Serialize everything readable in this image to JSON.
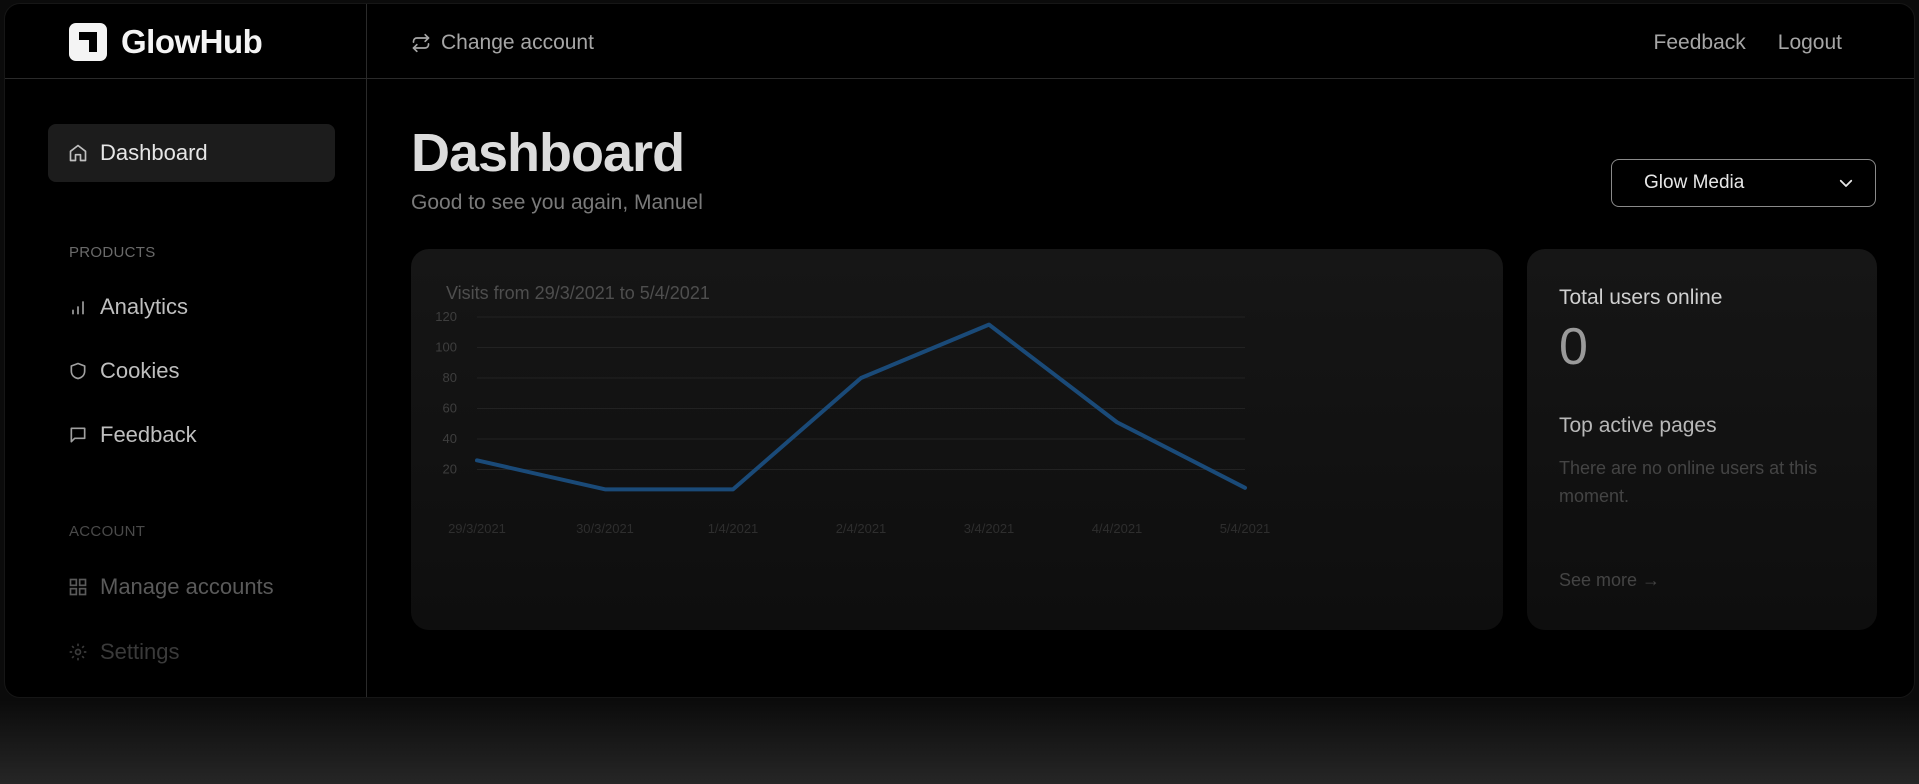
{
  "app": {
    "name": "GlowHub"
  },
  "topbar": {
    "change_account": "Change account",
    "feedback": "Feedback",
    "logout": "Logout"
  },
  "sidebar": {
    "dashboard": "Dashboard",
    "products_label": "PRODUCTS",
    "analytics": "Analytics",
    "cookies": "Cookies",
    "feedback": "Feedback",
    "account_label": "ACCOUNT",
    "manage_accounts": "Manage accounts",
    "settings": "Settings"
  },
  "main": {
    "title": "Dashboard",
    "subtitle": "Good to see you again, Manuel",
    "account_select": "Glow Media"
  },
  "chart_data": {
    "type": "line",
    "title": "Visits from 29/3/2021 to 5/4/2021",
    "categories": [
      "29/3/2021",
      "30/3/2021",
      "1/4/2021",
      "2/4/2021",
      "3/4/2021",
      "4/4/2021",
      "5/4/2021"
    ],
    "series": [
      {
        "values": [
          26,
          7,
          7,
          80,
          115,
          51,
          8
        ]
      }
    ],
    "yticks": [
      20,
      40,
      60,
      80,
      100,
      120
    ],
    "ylim": [
      0,
      120
    ],
    "grid": true,
    "line_color": "#1a4a78"
  },
  "stats": {
    "total_users_label": "Total users online",
    "total_users_value": "0",
    "top_pages_label": "Top active pages",
    "top_pages_empty": "There are no online users at this moment.",
    "see_more": "See more →"
  }
}
